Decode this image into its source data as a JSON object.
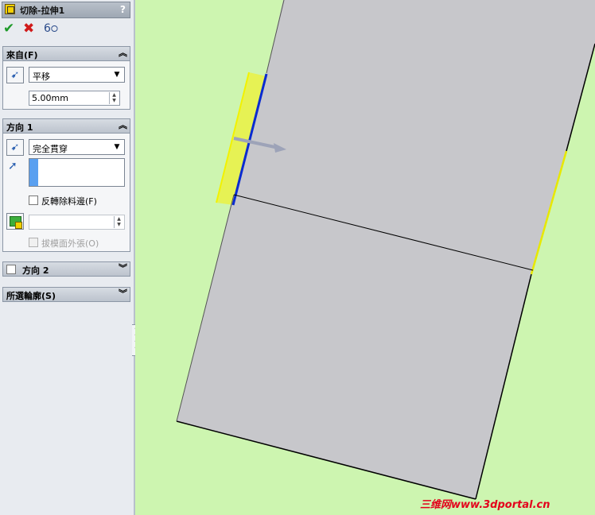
{
  "feature": {
    "title": "切除-拉伸1",
    "help": "?"
  },
  "actions": {
    "ok": "✔",
    "cancel": "✖",
    "preview": "6੦"
  },
  "from": {
    "header": "來自(F)",
    "type_value": "平移",
    "offset_value": "5.00mm"
  },
  "direction1": {
    "header": "方向 1",
    "end_condition_value": "完全貫穿",
    "flip_side_label": "反轉除料邊(F)",
    "draft_outward_label": "拔模面外張(O)"
  },
  "direction2": {
    "header": "方向 2"
  },
  "selected_contours": {
    "header": "所選輪廓(S)"
  },
  "watermark": "三维网www.3dportal.cn",
  "colors": {
    "background": "#cdf5b0",
    "part_face": "#c8c8cc",
    "selection_blue": "#0a2bd0",
    "highlight_yellow": "#f0f000",
    "ok_green": "#1f9a2a",
    "cancel_red": "#d01a1a"
  }
}
